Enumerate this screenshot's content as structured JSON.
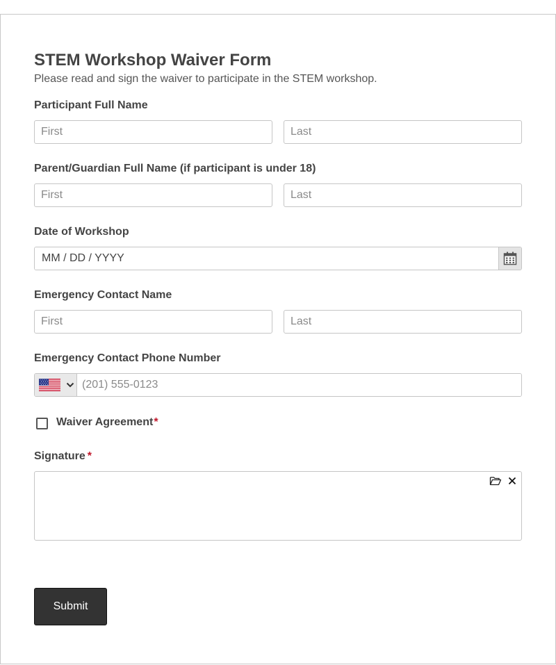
{
  "form": {
    "title": "STEM Workshop Waiver Form",
    "description": "Please read and sign the waiver to participate in the STEM workshop."
  },
  "participant_name": {
    "label": "Participant Full Name",
    "first_placeholder": "First",
    "last_placeholder": "Last"
  },
  "guardian_name": {
    "label": "Parent/Guardian Full Name (if participant is under 18)",
    "first_placeholder": "First",
    "last_placeholder": "Last"
  },
  "workshop_date": {
    "label": "Date of Workshop",
    "placeholder": "MM / DD / YYYY",
    "icon": "calendar-icon"
  },
  "emergency_contact_name": {
    "label": "Emergency Contact Name",
    "first_placeholder": "First",
    "last_placeholder": "Last"
  },
  "emergency_phone": {
    "label": "Emergency Contact Phone Number",
    "country_icon": "us-flag-icon",
    "placeholder": "(201) 555-0123"
  },
  "waiver_agreement": {
    "label": "Waiver Agreement",
    "required_mark": "*",
    "checked": false
  },
  "signature": {
    "label": "Signature",
    "required_mark": "*",
    "upload_icon": "folder-open-icon",
    "clear_icon": "close-icon"
  },
  "submit": {
    "label": "Submit"
  },
  "colors": {
    "text": "#444444",
    "required": "#c0172b",
    "button_bg": "#333333",
    "border": "#c5c5c5"
  }
}
